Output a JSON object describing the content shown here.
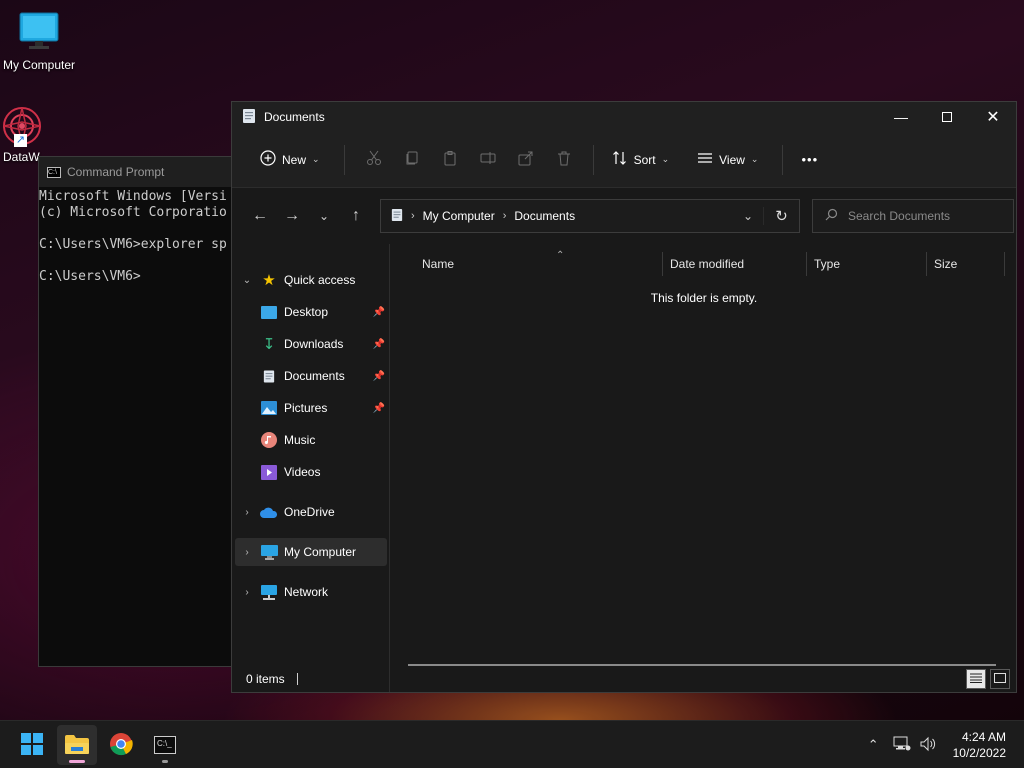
{
  "desktop": {
    "icons": [
      {
        "label": "My Computer"
      },
      {
        "label": "DataW"
      }
    ]
  },
  "cmd": {
    "title": "Command Prompt",
    "lines": [
      "Microsoft Windows [Versi",
      "(c) Microsoft Corporatio",
      "",
      "C:\\Users\\VM6>explorer sp",
      "",
      "C:\\Users\\VM6>"
    ]
  },
  "explorer": {
    "title": "Documents",
    "toolbar": {
      "new_label": "New",
      "sort_label": "Sort",
      "view_label": "View",
      "more_label": "•••"
    },
    "address": {
      "crumbs": [
        "My Computer",
        "Documents"
      ]
    },
    "search": {
      "placeholder": "Search Documents"
    },
    "nav": {
      "quick_access": "Quick access",
      "items": [
        {
          "label": "Desktop"
        },
        {
          "label": "Downloads"
        },
        {
          "label": "Documents"
        },
        {
          "label": "Pictures"
        },
        {
          "label": "Music"
        },
        {
          "label": "Videos"
        }
      ],
      "onedrive": "OneDrive",
      "my_computer": "My Computer",
      "network": "Network"
    },
    "columns": {
      "name": "Name",
      "date": "Date modified",
      "type": "Type",
      "size": "Size"
    },
    "empty_text": "This folder is empty.",
    "status": {
      "items": "0 items"
    }
  },
  "taskbar": {
    "time": "4:24 AM",
    "date": "10/2/2022"
  },
  "colors": {
    "accent": "#60cdff",
    "folder": "#f4c542",
    "explorer_indicator": "#f0a6d8"
  }
}
